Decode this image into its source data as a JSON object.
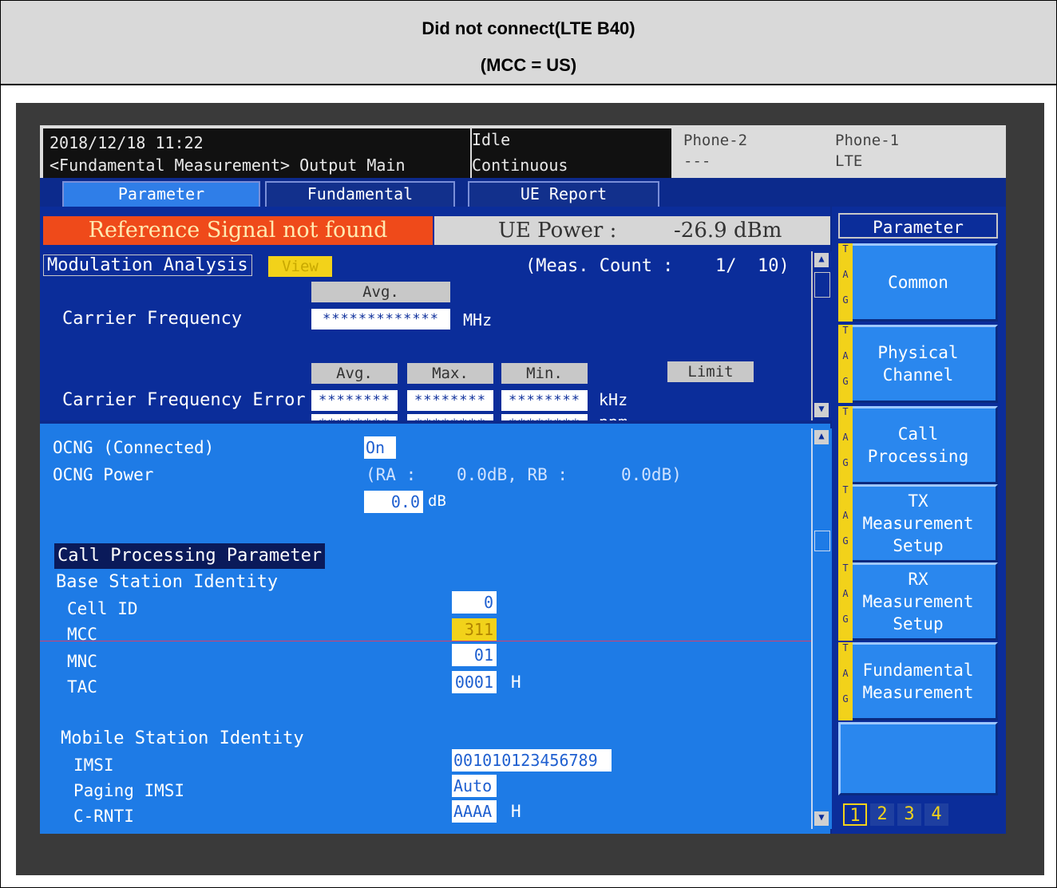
{
  "caption": {
    "line1": "Did not connect(LTE B40)",
    "line2": "(MCC = US)"
  },
  "status": {
    "datetime": "2018/12/18 11:22",
    "screen": "<Fundamental Measurement> Output Main",
    "state": "Idle",
    "mode": "Continuous",
    "phone2_label": "Phone-2",
    "phone2_value": "---",
    "phone1_label": "Phone-1",
    "phone1_value": "LTE"
  },
  "tabs": [
    "Parameter",
    "Fundamental",
    "UE Report"
  ],
  "alert": "Reference Signal not found",
  "ue_power": {
    "label": "UE Power :",
    "value": "-26.9 dBm"
  },
  "modulation": {
    "title": "Modulation Analysis",
    "view_button": "View",
    "meas_count": "(Meas. Count :",
    "meas_value": "1/  10)",
    "avg_button": "Avg.",
    "carrier_freq_label": "Carrier Frequency",
    "carrier_freq_value": "*************",
    "carrier_freq_unit": "MHz",
    "error_label": "Carrier Frequency Error",
    "col_avg": "Avg.",
    "col_max": "Max.",
    "col_min": "Min.",
    "limit_button": "Limit",
    "err_value": "********",
    "err_unit_khz": "kHz",
    "err_unit_ppm": "ppm"
  },
  "params": {
    "ocng_connected_label": "OCNG (Connected)",
    "ocng_connected_value": "On",
    "ocng_power_label": "OCNG Power",
    "ocng_power_ra": "(RA :",
    "ocng_power_ra_val": "0.0dB, RB :",
    "ocng_power_rb_val": "0.0dB)",
    "ocng_power_value": "0.0",
    "ocng_power_unit": "dB",
    "section_title": "Call Processing Parameter",
    "bs_identity": "Base Station Identity",
    "cell_id_label": "Cell ID",
    "cell_id_value": "0",
    "mcc_label": "MCC",
    "mcc_value": "311",
    "mnc_label": "MNC",
    "mnc_value": "01",
    "tac_label": "TAC",
    "tac_value": "0001",
    "tac_unit": "H",
    "ms_identity": "Mobile Station Identity",
    "imsi_label": "IMSI",
    "imsi_value": "001010123456789",
    "paging_imsi_label": "Paging IMSI",
    "paging_imsi_value": "Auto",
    "crnti_label": "C-RNTI",
    "crnti_value": "AAAA",
    "crnti_unit": "H"
  },
  "side": {
    "header": "Parameter",
    "buttons": [
      "Common",
      "Physical\nChannel",
      "Call\nProcessing",
      "TX\nMeasurement\nSetup",
      "RX\nMeasurement\nSetup",
      "Fundamental\nMeasurement",
      ""
    ],
    "tag_letters": [
      "T",
      "A",
      "G"
    ],
    "pages": [
      "1",
      "2",
      "3",
      "4"
    ]
  },
  "colors": {
    "screen_dark": "#0b2d9a",
    "screen_light": "#1e7be6",
    "alert": "#ef4a1a",
    "highlight": "#f2d21a"
  }
}
